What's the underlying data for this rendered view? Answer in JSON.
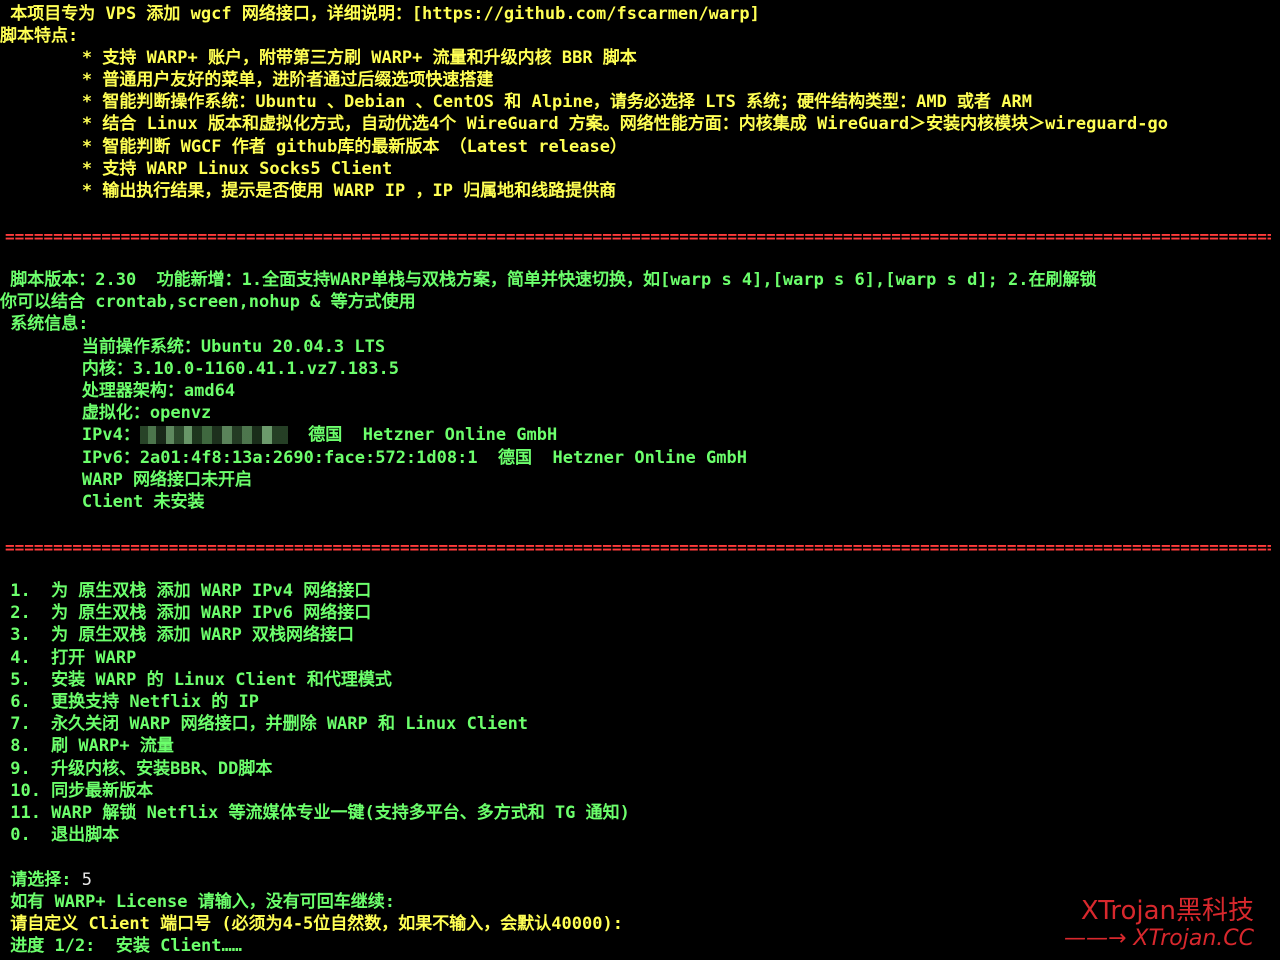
{
  "intro": {
    "line1": " 本项目专为 VPS 添加 wgcf 网络接口，详细说明：[https://github.com/fscarmen/warp]",
    "line2": "脚本特点:",
    "features": [
      "        * 支持 WARP+ 账户，附带第三方刷 WARP+ 流量和升级内核 BBR 脚本",
      "        * 普通用户友好的菜单，进阶者通过后缀选项快速搭建",
      "        * 智能判断操作系统：Ubuntu 、Debian 、CentOS 和 Alpine，请务必选择 LTS 系统；硬件结构类型：AMD 或者 ARM",
      "        * 结合 Linux 版本和虚拟化方式，自动优选4个 WireGuard 方案。网络性能方面：内核集成 WireGuard＞安装内核模块＞wireguard-go",
      "        * 智能判断 WGCF 作者 github库的最新版本 （Latest release）",
      "        * 支持 WARP Linux Socks5 Client",
      "        * 输出执行结果，提示是否使用 WARP IP ，IP 归属地和线路提供商"
    ]
  },
  "separator": "===================================================================================================================================================",
  "info": {
    "version_line": " 脚本版本：2.30  功能新增：1.全面支持WARP单栈与双栈方案，简单并快速切换，如[warp s 4],[warp s 6],[warp s d]; 2.在刷解锁",
    "usage_line": "你可以结合 crontab,screen,nohup & 等方式使用",
    "sysinfo_title": " 系统信息:",
    "os": "        当前操作系统：Ubuntu 20.04.3 LTS",
    "kernel": "        内核：3.10.0-1160.41.1.vz7.183.5",
    "arch": "        处理器架构：amd64",
    "virt": "        虚拟化：openvz",
    "ipv4_label": "        IPv4：",
    "ipv4_suffix": "  德国  Hetzner Online GmbH",
    "ipv6": "        IPv6：2a01:4f8:13a:2690:face:572:1d08:1  德国  Hetzner Online GmbH",
    "warp_status": "        WARP 网络接口未开启",
    "client_status": "        Client 未安装"
  },
  "menu": [
    " 1.  为 原生双栈 添加 WARP IPv4 网络接口",
    " 2.  为 原生双栈 添加 WARP IPv6 网络接口",
    " 3.  为 原生双栈 添加 WARP 双栈网络接口",
    " 4.  打开 WARP",
    " 5.  安装 WARP 的 Linux Client 和代理模式",
    " 6.  更换支持 Netflix 的 IP",
    " 7.  永久关闭 WARP 网络接口，并删除 WARP 和 Linux Client",
    " 8.  刷 WARP+ 流量",
    " 9.  升级内核、安装BBR、DD脚本",
    " 10. 同步最新版本",
    " 11. WARP 解锁 Netflix 等流媒体专业一键(支持多平台、多方式和 TG 通知)",
    " 0.  退出脚本"
  ],
  "prompt": {
    "choice_label": " 请选择: ",
    "choice_value": "5",
    "license": " 如有 WARP+ License 请输入，没有可回车继续:",
    "port": " 请自定义 Client 端口号 (必须为4-5位自然数，如果不输入，会默认40000):",
    "progress": " 进度 1/2:  安装 Client……"
  },
  "watermark": {
    "title": "XTrojan黑科技",
    "subtitle": "——→ XTrojan.CC"
  },
  "colors": {
    "background": "#000000",
    "yellow": "#ffff54",
    "green": "#6cff6c",
    "red": "#ff3b3b",
    "watermark": "#d8282d"
  }
}
